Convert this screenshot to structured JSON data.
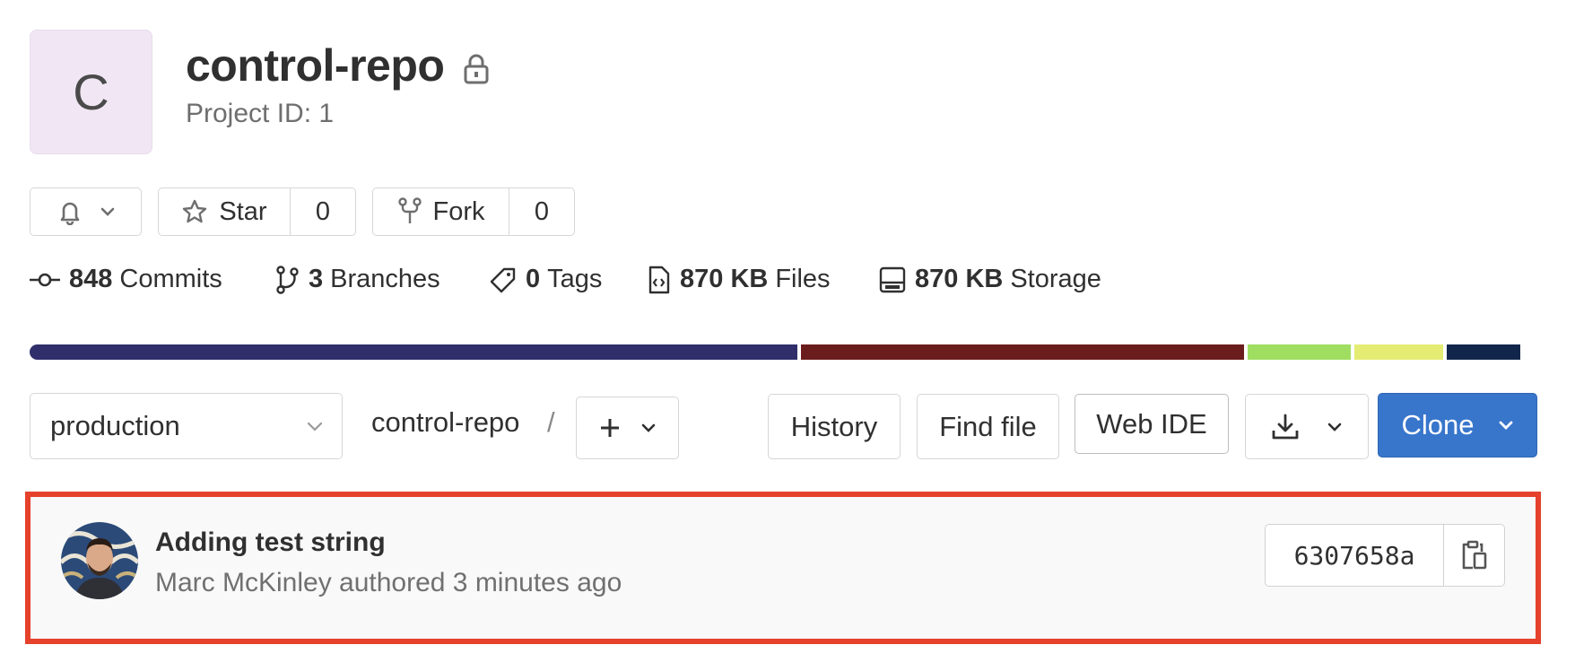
{
  "project": {
    "avatar_letter": "C",
    "name": "control-repo",
    "project_id_text": "Project ID: 1"
  },
  "actions": {
    "star_label": "Star",
    "star_count": "0",
    "fork_label": "Fork",
    "fork_count": "0"
  },
  "stats": {
    "commits_count": "848",
    "commits_label": "Commits",
    "branches_count": "3",
    "branches_label": "Branches",
    "tags_count": "0",
    "tags_label": "Tags",
    "files_size": "870 KB",
    "files_label": "Files",
    "storage_size": "870 KB",
    "storage_label": "Storage"
  },
  "languages": [
    {
      "color": "#302e6b",
      "share": 0.52
    },
    {
      "color": "#6b1c1c",
      "share": 0.3
    },
    {
      "color": "#9fde61",
      "share": 0.07
    },
    {
      "color": "#e4ec74",
      "share": 0.06
    },
    {
      "color": "#12264c",
      "share": 0.05
    }
  ],
  "toolbar": {
    "branch": "production",
    "repo_path": "control-repo",
    "path_separator": "/",
    "history_label": "History",
    "find_file_label": "Find file",
    "web_ide_label": "Web IDE",
    "clone_label": "Clone"
  },
  "last_commit": {
    "title": "Adding test string",
    "meta": "Marc McKinley authored 3 minutes ago",
    "sha": "6307658a"
  },
  "colors": {
    "clone_button": "#3876cc",
    "highlight_border": "#e5412b"
  }
}
